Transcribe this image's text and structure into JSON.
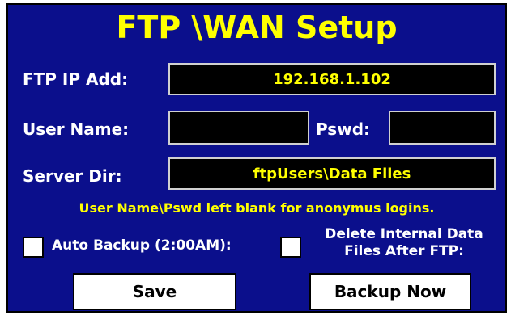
{
  "title": "FTP \\WAN Setup",
  "ftp_ip": {
    "label": "FTP IP Add:",
    "value": "192.168.1.102"
  },
  "user": {
    "label": "User Name:",
    "value": ""
  },
  "pswd": {
    "label": "Pswd:",
    "value": ""
  },
  "server_dir": {
    "label": "Server Dir:",
    "value": "ftpUsers\\Data Files"
  },
  "note": "User Name\\Pswd left blank for anonymus logins.",
  "auto_backup": {
    "label": "Auto Backup (2:00AM):",
    "checked": false
  },
  "delete_after": {
    "label_line1": "Delete Internal Data",
    "label_line2": "Files After FTP:",
    "checked": false
  },
  "buttons": {
    "save": "Save",
    "backup_now": "Backup Now"
  },
  "colors": {
    "panel_bg": "#0b0f8c",
    "accent_text": "#ffff00",
    "label_text": "#ffffff",
    "field_bg": "#000000"
  }
}
